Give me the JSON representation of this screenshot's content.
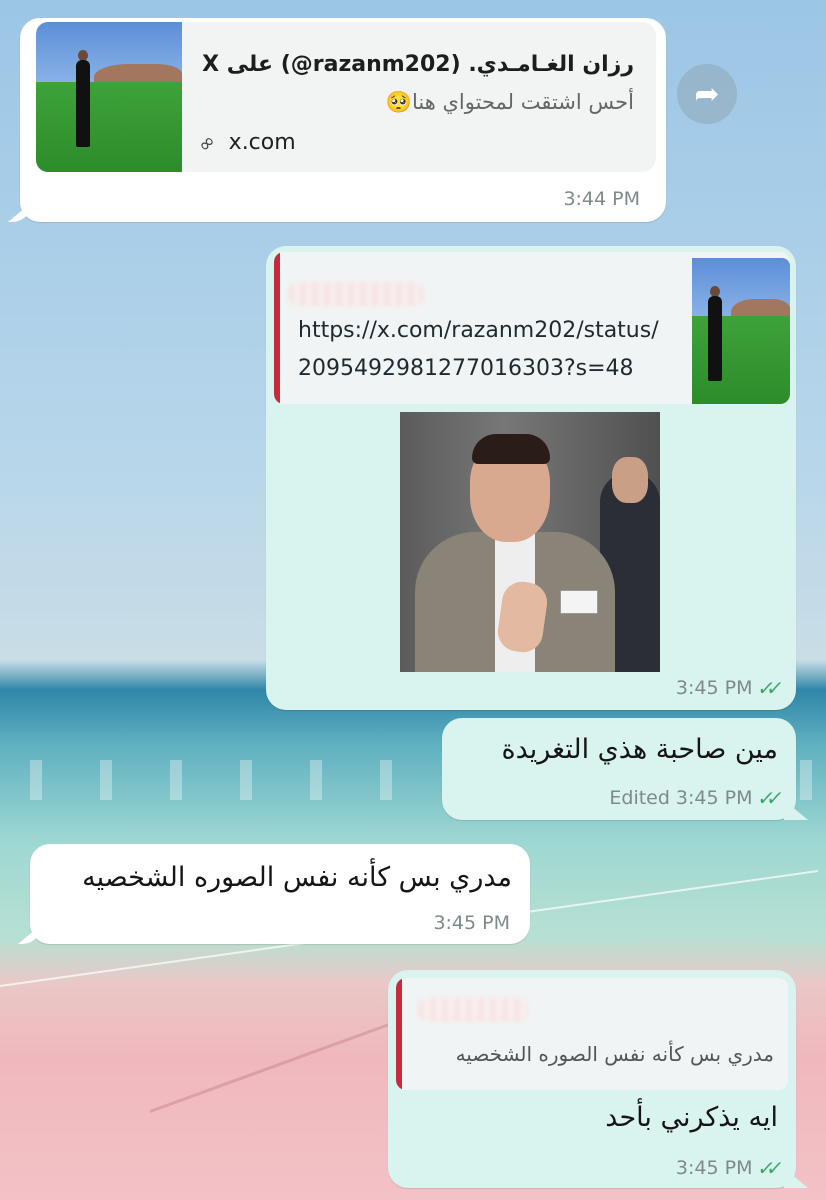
{
  "chat": {
    "msg1": {
      "preview_title": "رزان الغـامـدي. (razanm202@) على X",
      "preview_desc": "أحس اشتقت لمحتواي هنا🥺",
      "preview_domain": "x.com",
      "time": "3:44 PM"
    },
    "msg2": {
      "link_line1": "https://x.com/razanm202/status/",
      "link_line2": "2095492981277016303?s=48",
      "time": "3:45 PM"
    },
    "msg3": {
      "text": "مين صاحبة هذي التغريدة",
      "edited_label": "Edited",
      "time": "3:45 PM"
    },
    "msg4": {
      "text": "مدري بس كأنه نفس الصوره الشخصيه",
      "time": "3:45 PM"
    },
    "msg5": {
      "quoted_text": "مدري بس كأنه نفس الصوره الشخصيه",
      "text": "ايه يذكرني بأحد",
      "time": "3:45 PM"
    }
  },
  "icons": {
    "forward": "forward-arrow-icon",
    "link": "link-icon",
    "read": "double-check-icon"
  },
  "colors": {
    "incoming_bubble": "#ffffff",
    "outgoing_bubble": "#d9f3ee",
    "quote_bar": "#c62b3d",
    "read_ticks": "#3aa36a"
  }
}
